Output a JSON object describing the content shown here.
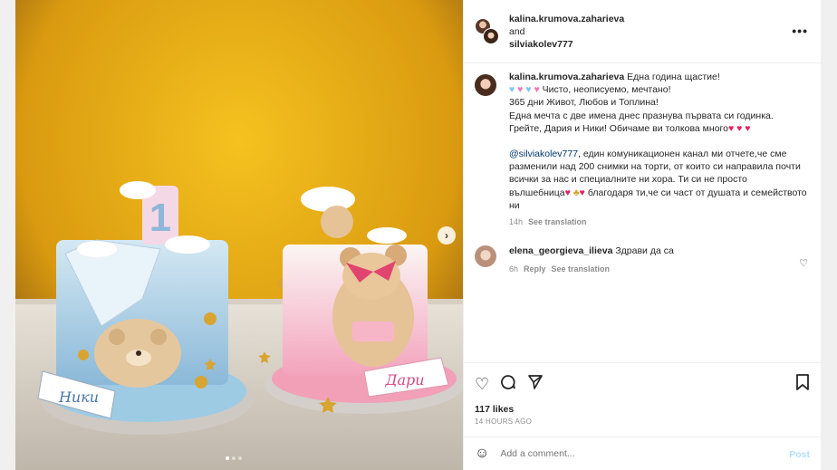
{
  "header": {
    "user1": "kalina.krumova.zaharieva",
    "joiner": "and",
    "user2": "silviakolev777",
    "more": "•••"
  },
  "caption": {
    "username": "kalina.krumova.zaharieva",
    "line1": "Една година щастие!",
    "line2": "Чисто, неописуемо, мечтано!",
    "line3": "365 дни Живот, Любов и Топлина!",
    "line4": "Една мечта с две имена днес празнува първата си годинка.",
    "line5": "Грейте, Дария и Ники! Обичаме ви толкова много",
    "mention": "@silviakolev777",
    "para2_rest": ", един комуникационен канал ми отчете,че сме разменили над 200 снимки на торти, от които си направила почти всички за нас и специалните ни хора. Ти си не просто вълшебница",
    "para2_end": "благодаря ти,че си част от душата и семейството ни",
    "time": "14h",
    "see_translation": "See translation"
  },
  "comment2": {
    "username": "elena_georgieva_ilieva",
    "text": "Здрави да са",
    "time": "6h",
    "reply": "Reply",
    "see_translation": "See translation"
  },
  "likes": "117 likes",
  "post_time": "14 HOURS AGO",
  "add_comment": {
    "placeholder": "Add a comment...",
    "post_label": "Post"
  },
  "media": {
    "cake_left_text": "Ники",
    "cake_right_text": "Дари",
    "candle_number": "1"
  },
  "colors": {
    "blue_heart": "#7ec6f0",
    "pink_heart": "#f078b4",
    "red_heart": "#e0245e",
    "link": "#00376b",
    "post_disabled": "#b2dffc"
  }
}
